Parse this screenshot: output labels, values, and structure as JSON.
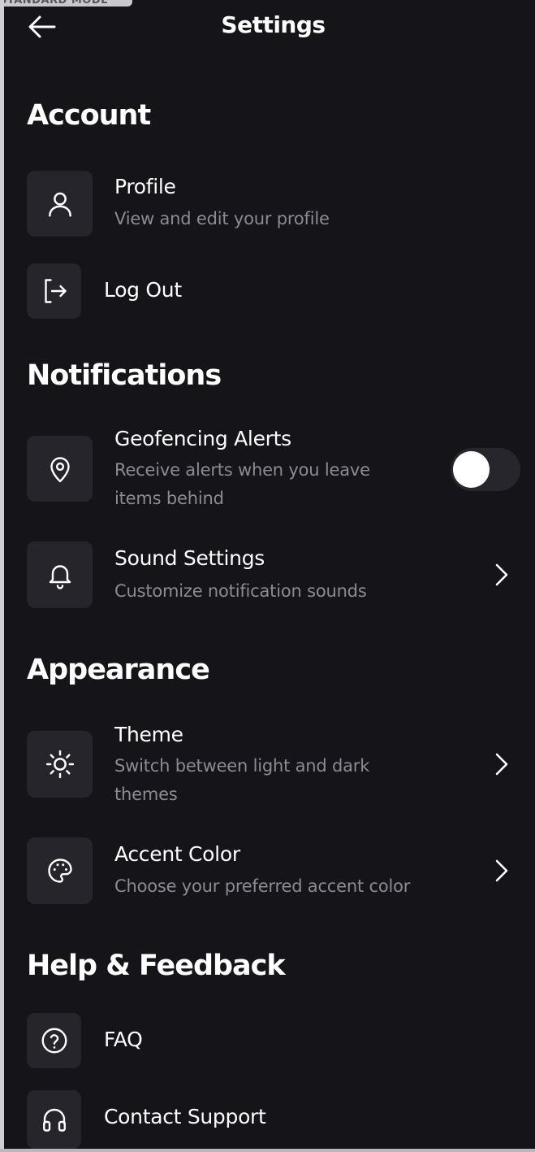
{
  "app": {
    "mode_label": "STANDARD MODE"
  },
  "header": {
    "title": "Settings",
    "back_icon": "arrow-left-icon"
  },
  "sections": {
    "account": {
      "title": "Account"
    },
    "notifications": {
      "title": "Notifications"
    },
    "appearance": {
      "title": "Appearance"
    },
    "help": {
      "title": "Help & Feedback"
    }
  },
  "items": {
    "profile": {
      "title": "Profile",
      "subtitle": "View and edit your profile",
      "icon": "user-icon"
    },
    "logout": {
      "title": "Log Out",
      "icon": "logout-icon"
    },
    "geofencing": {
      "title": "Geofencing Alerts",
      "subtitle_line1": "Receive alerts when you leave",
      "subtitle_line2": "items behind",
      "icon": "location-pin-icon",
      "toggle_on": false
    },
    "sound": {
      "title": "Sound Settings",
      "subtitle": "Customize notification sounds",
      "icon": "bell-icon"
    },
    "theme": {
      "title": "Theme",
      "subtitle_line1": "Switch between light and dark",
      "subtitle_line2": "themes",
      "icon": "sun-icon"
    },
    "accent": {
      "title": "Accent Color",
      "subtitle": "Choose your preferred accent color",
      "icon": "palette-icon"
    },
    "faq": {
      "title": "FAQ",
      "icon": "help-circle-icon"
    },
    "support": {
      "title": "Contact Support",
      "icon": "headphones-icon"
    }
  },
  "colors": {
    "background": "#151419",
    "icon_tile": "#26252b",
    "text_primary": "#ffffff",
    "text_secondary": "#8c8b93",
    "toggle_track": "#27262c"
  }
}
